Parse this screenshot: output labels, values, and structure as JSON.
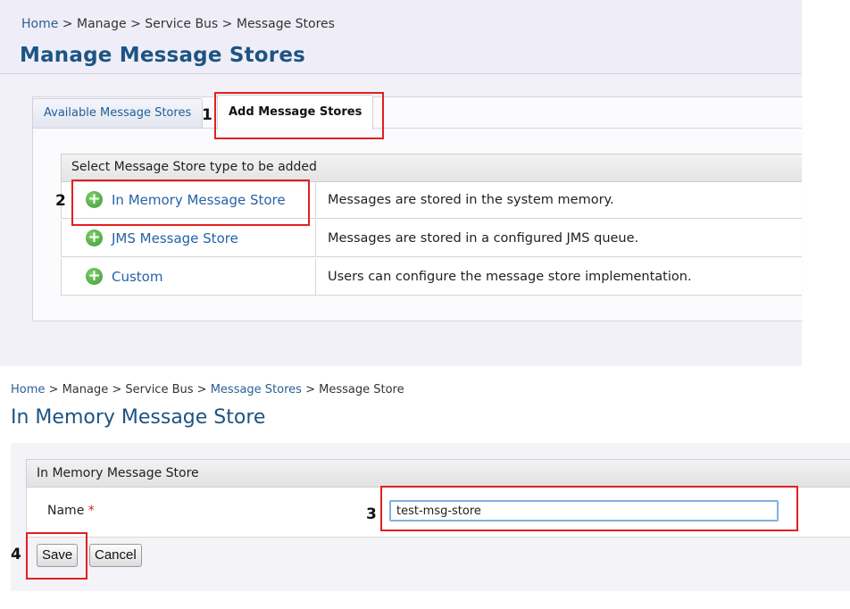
{
  "top": {
    "breadcrumb": {
      "home": "Home",
      "sep": ">",
      "manage": "Manage",
      "service_bus": "Service Bus",
      "message_stores": "Message Stores"
    },
    "title": "Manage Message Stores",
    "tabs": [
      {
        "label": "Available Message Stores",
        "active": false
      },
      {
        "label": "Add Message Stores",
        "active": true
      }
    ],
    "table": {
      "header": "Select Message Store type to be added",
      "rows": [
        {
          "label": "In Memory Message Store",
          "description": "Messages are stored in the system memory."
        },
        {
          "label": "JMS Message Store",
          "description": "Messages are stored in a configured JMS queue."
        },
        {
          "label": "Custom",
          "description": "Users can configure the message store implementation."
        }
      ]
    }
  },
  "bottom": {
    "breadcrumb": {
      "home": "Home",
      "manage": "Manage",
      "service_bus": "Service Bus",
      "message_stores": "Message Stores",
      "message_store": "Message Store"
    },
    "title": "In Memory Message Store",
    "form": {
      "header": "In Memory Message Store",
      "name_label": "Name",
      "required_mark": "*",
      "name_value": "test-msg-store"
    },
    "buttons": {
      "save": "Save",
      "cancel": "Cancel"
    }
  },
  "callouts": {
    "tab": "1",
    "store_link": "2",
    "name_input": "3",
    "save_button": "4"
  },
  "colors": {
    "highlight": "#e02020",
    "link": "#2563a8",
    "title": "#1d5483",
    "add_icon": "#3f9b3a"
  },
  "icons": {
    "add": "plus-circle-icon"
  }
}
